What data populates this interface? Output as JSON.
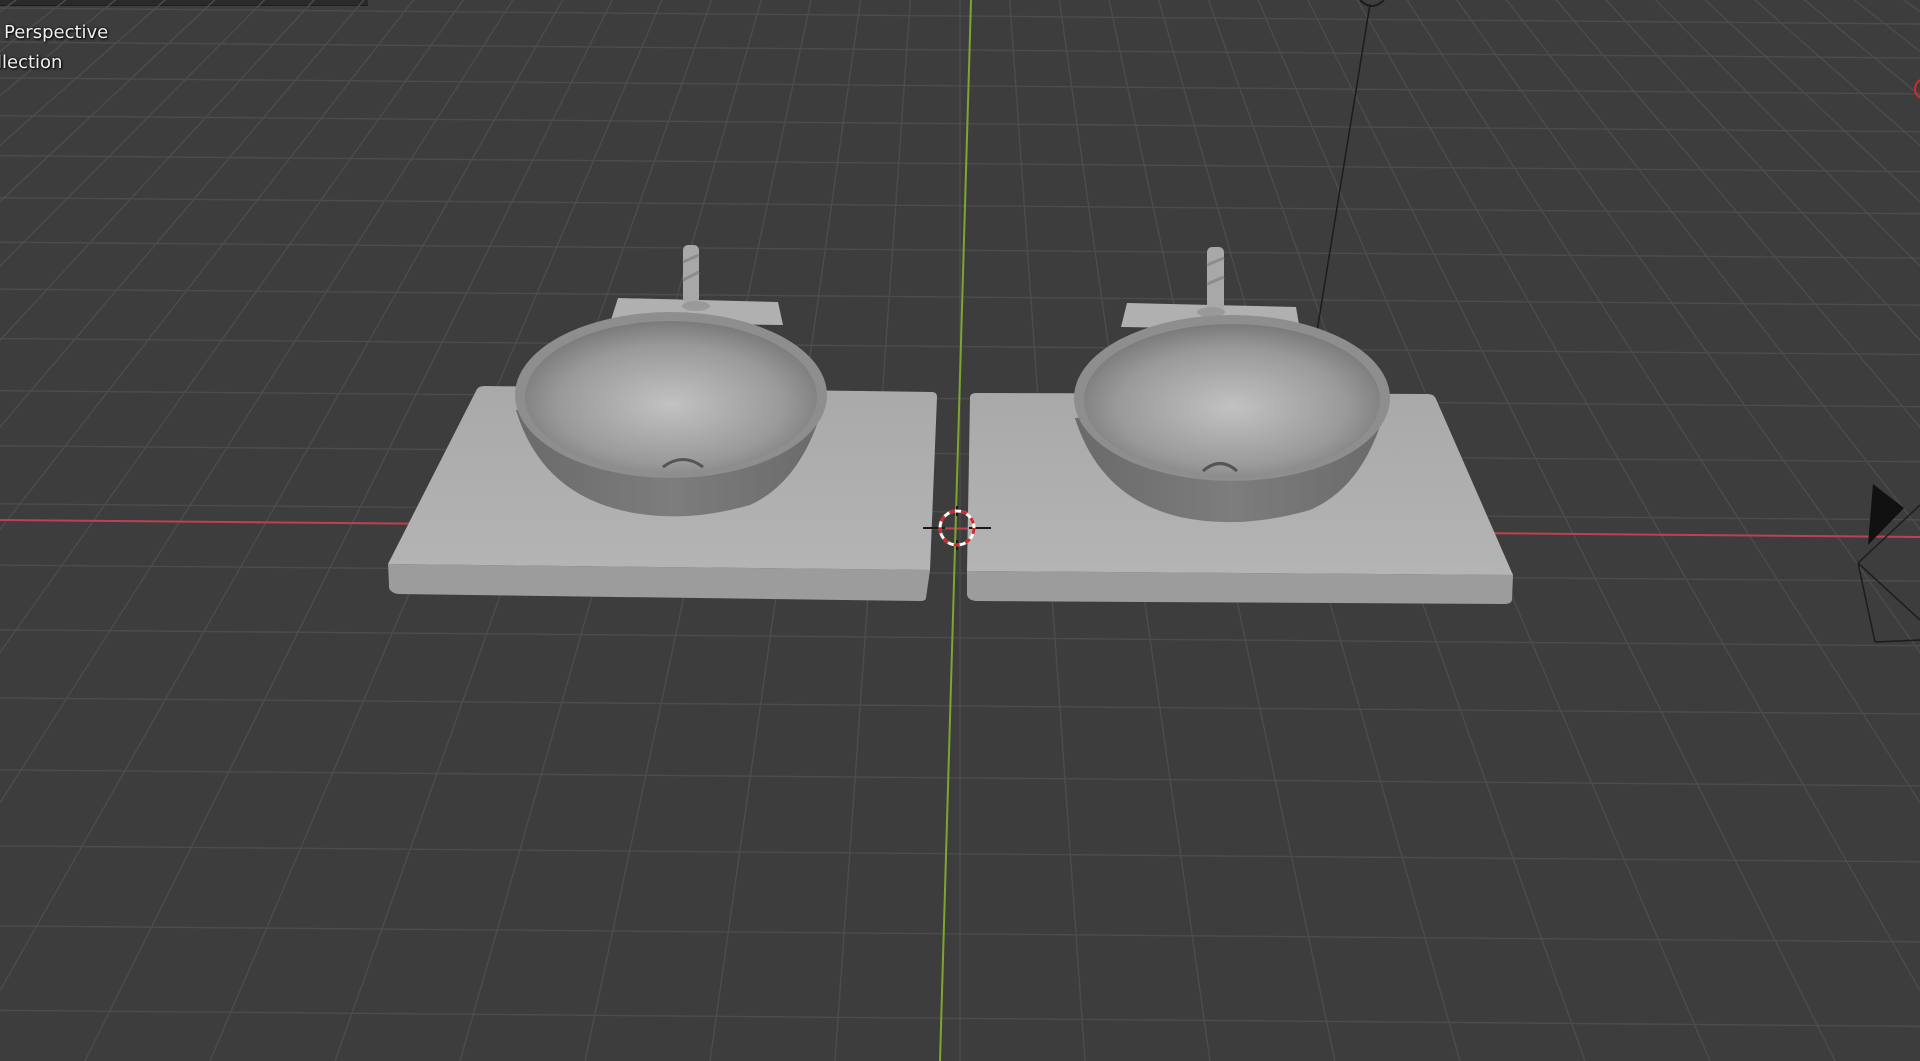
{
  "viewport": {
    "view_label": "Perspective",
    "collection_label": "ollection",
    "background_color": "#3d3d3d",
    "grid_color": "#4c4c4c",
    "x_axis_color": "#c1404f",
    "y_axis_color": "#7ea62c",
    "cursor_icon": "3d-cursor-icon",
    "light_icon": "light-icon",
    "camera_icon": "camera-icon",
    "objects": [
      {
        "name": "basin-left",
        "type": "sink-with-countertop"
      },
      {
        "name": "basin-right",
        "type": "sink-with-countertop"
      }
    ]
  }
}
